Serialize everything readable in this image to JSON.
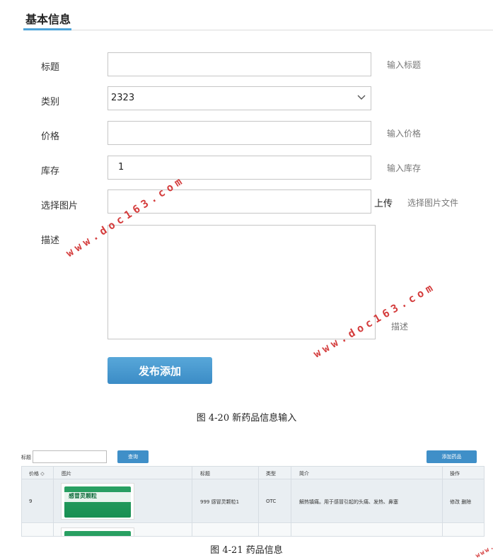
{
  "form": {
    "tab_title": "基本信息",
    "fields": {
      "title": {
        "label": "标题",
        "value": "",
        "hint": "输入标题"
      },
      "category": {
        "label": "类别",
        "value": "2323"
      },
      "price": {
        "label": "价格",
        "value": "",
        "hint": "输入价格"
      },
      "stock": {
        "label": "库存",
        "value": "1",
        "hint": "输入库存"
      },
      "image": {
        "label": "选择图片",
        "upload_label": "上传",
        "hint": "选择图片文件"
      },
      "description": {
        "label": "描述",
        "hint": "描述"
      }
    },
    "submit_label": "发布添加"
  },
  "caption1": "图 4-20 新药品信息输入",
  "table_view": {
    "search_label": "标题",
    "query_label": "查询",
    "add_label": "添加药品",
    "columns": [
      "价格 ◇",
      "图片",
      "标题",
      "类型",
      "简介",
      "操作"
    ],
    "rows": [
      {
        "price": "9",
        "image_text": "感冒灵颗粒",
        "title": "999 感冒灵颗粒1",
        "type": "OTC",
        "intro": "解热镇痛。用于感冒引起的头痛、发热、鼻塞",
        "actions": "修改 删除"
      },
      {
        "price": "",
        "image_text": "",
        "title": "",
        "type": "",
        "intro": "",
        "actions": ""
      }
    ]
  },
  "caption2": "图 4-21 药品信息",
  "watermark": "www.doc163.com",
  "watermark_small": "www.doc163.com",
  "colors": {
    "accent": "#3f8fc8",
    "watermark": "#d43c3c"
  }
}
